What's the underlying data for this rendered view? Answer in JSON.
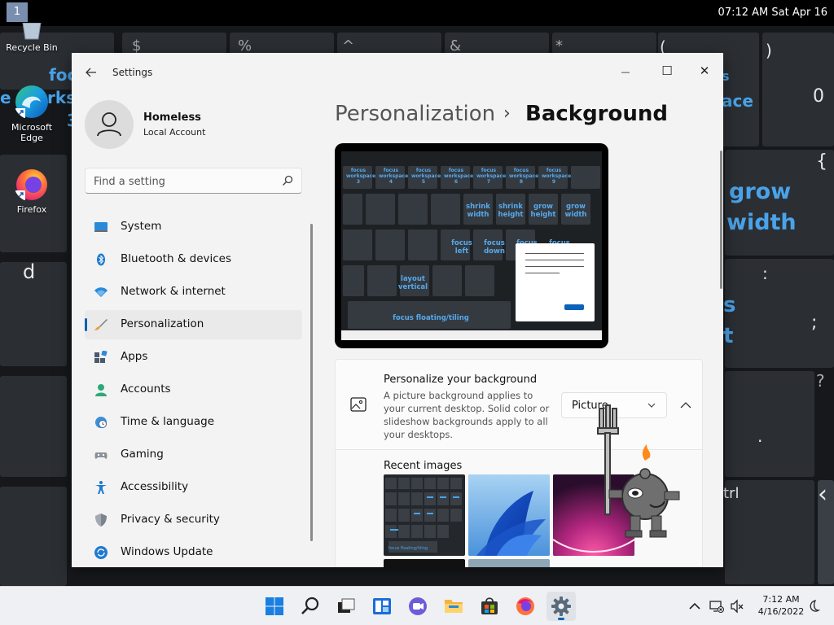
{
  "topbar": {
    "workspace": "1",
    "clock": "07:12 AM   Sat Apr 16"
  },
  "desktop": {
    "icons": [
      {
        "label": "Recycle Bin"
      },
      {
        "label": "Microsoft Edge"
      },
      {
        "label": "Firefox"
      }
    ],
    "wallpaper_text": {
      "t1": "foc",
      "t2": "rks",
      "t3": "3",
      "t4": "e",
      "grow": "grow",
      "width": "width",
      "s": "s",
      "t": "t",
      "ace": "ace",
      "s2": "s"
    },
    "wallpaper_glyphs": {
      "dollar": "$",
      "percent": "%",
      "caret": "^",
      "amp": "&",
      "star": "*",
      "lparen": "(",
      "rparen": ")",
      "zero": "0",
      "brace": "{",
      "d": "d",
      "colon": ":",
      "semicolon": ";",
      "question": "?",
      "dot": ".",
      "trl": "trl",
      "chevron": "‹"
    }
  },
  "window": {
    "title": "Settings",
    "controls": {
      "minimize": "—",
      "maximize": "☐",
      "close": "✕"
    }
  },
  "profile": {
    "name": "Homeless",
    "account_type": "Local Account"
  },
  "search": {
    "placeholder": "Find a setting"
  },
  "nav": {
    "items": [
      {
        "label": "System",
        "icon": "monitor-icon"
      },
      {
        "label": "Bluetooth & devices",
        "icon": "bluetooth-icon"
      },
      {
        "label": "Network & internet",
        "icon": "wifi-icon"
      },
      {
        "label": "Personalization",
        "icon": "brush-icon",
        "active": true
      },
      {
        "label": "Apps",
        "icon": "apps-icon"
      },
      {
        "label": "Accounts",
        "icon": "person-icon"
      },
      {
        "label": "Time & language",
        "icon": "globe-clock-icon"
      },
      {
        "label": "Gaming",
        "icon": "gamepad-icon"
      },
      {
        "label": "Accessibility",
        "icon": "accessibility-icon"
      },
      {
        "label": "Privacy & security",
        "icon": "shield-icon"
      },
      {
        "label": "Windows Update",
        "icon": "update-icon"
      }
    ]
  },
  "breadcrumb": {
    "parent": "Personalization",
    "separator": "›",
    "current": "Background"
  },
  "preview": {
    "keys": {
      "fw3": "focus workspace 3",
      "fw4": "focus workspace 4",
      "fw5": "focus workspace 5",
      "fw6": "focus workspace 6",
      "fw7": "focus workspace 7",
      "fw8": "focus workspace 8",
      "fw9": "focus workspace 9",
      "shrink_width": "shrink width",
      "shrink_height": "shrink height",
      "grow_height": "grow height",
      "grow_width": "grow width",
      "focus_left": "focus left",
      "focus_down": "focus down",
      "focus_up": "focus",
      "focus_right": "focus",
      "layout_vertical": "layout vertical",
      "focus_floating": "focus floating/tiling"
    }
  },
  "background_card": {
    "title": "Personalize your background",
    "description": "A picture background applies to your current desktop. Solid color or slideshow backgrounds apply to all your desktops.",
    "select_value": "Picture"
  },
  "recent": {
    "title": "Recent images",
    "thumb_caption": "focus floating/tiling"
  },
  "tray": {
    "time": "7:12 AM",
    "date": "4/16/2022"
  },
  "colors": {
    "accent": "#005fb8",
    "wallpaper_text": "#4aa3ea",
    "window_bg": "#f3f3f3"
  }
}
